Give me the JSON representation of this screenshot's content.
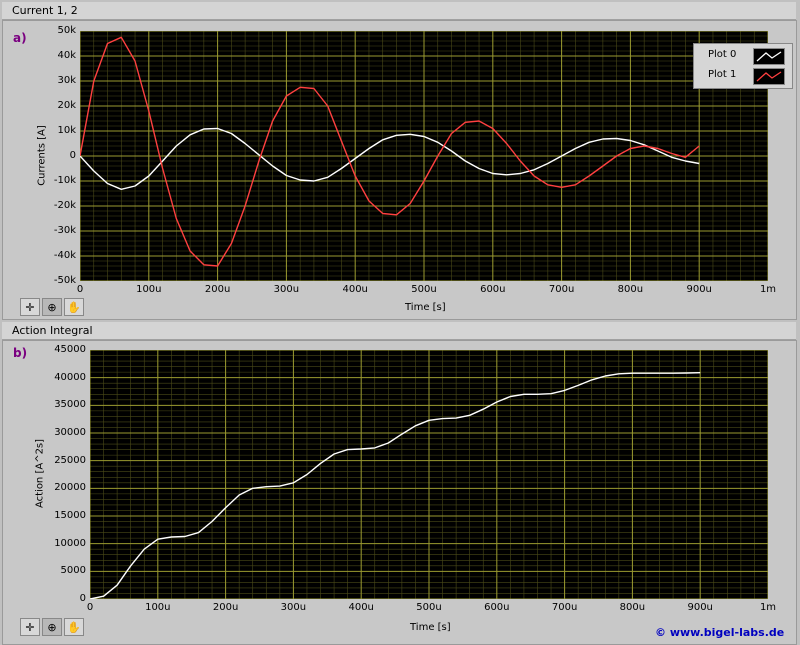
{
  "window": {
    "title": "Current 1, 2"
  },
  "colors": {
    "grid_major": "#9a9a30",
    "grid_minor": "#4a4a18",
    "series0": "#ffffff",
    "series1": "#ff4040",
    "background": "#000000"
  },
  "chart_data": [
    {
      "panel_label": "a)",
      "type": "line",
      "xlabel": "Time [s]",
      "ylabel": "Currents [A]",
      "xlim": [
        0,
        0.001
      ],
      "ylim": [
        -50000,
        50000
      ],
      "x_ticks": [
        "0",
        "100u",
        "200u",
        "300u",
        "400u",
        "500u",
        "600u",
        "700u",
        "800u",
        "900u",
        "1m"
      ],
      "y_ticks": [
        "50k",
        "40k",
        "30k",
        "20k",
        "10k",
        "0",
        "-10k",
        "-20k",
        "-30k",
        "-40k",
        "-50k"
      ],
      "legend": "top-right",
      "grid": true,
      "series": [
        {
          "name": "Plot 0",
          "color": "#ffffff",
          "x": [
            0,
            2e-05,
            4e-05,
            6e-05,
            8e-05,
            0.0001,
            0.00012,
            0.00014,
            0.00016,
            0.00018,
            0.0002,
            0.00022,
            0.00024,
            0.00026,
            0.00028,
            0.0003,
            0.00032,
            0.00034,
            0.00036,
            0.00038,
            0.0004,
            0.00042,
            0.00044,
            0.00046,
            0.00048,
            0.0005,
            0.00052,
            0.00054,
            0.00056,
            0.00058,
            0.0006,
            0.00062,
            0.00064,
            0.00066,
            0.00068,
            0.0007,
            0.00072,
            0.00074,
            0.00076,
            0.00078,
            0.0008,
            0.00082,
            0.00084,
            0.00086,
            0.00088,
            0.0009
          ],
          "y": [
            0,
            -6000,
            -11000,
            -13300,
            -12000,
            -8000,
            -2000,
            4000,
            8500,
            10800,
            11000,
            9000,
            5000,
            500,
            -4000,
            -7800,
            -9600,
            -10000,
            -8500,
            -5000,
            -1000,
            3000,
            6500,
            8300,
            8700,
            7800,
            5500,
            2000,
            -2000,
            -5000,
            -7000,
            -7500,
            -7000,
            -5500,
            -3000,
            0,
            3000,
            5500,
            6800,
            7000,
            6200,
            4500,
            2000,
            -500,
            -2000,
            -3000
          ]
        },
        {
          "name": "Plot 1",
          "color": "#ff4040",
          "x": [
            0,
            2e-05,
            4e-05,
            6e-05,
            8e-05,
            0.0001,
            0.00012,
            0.00014,
            0.00016,
            0.00018,
            0.0002,
            0.00022,
            0.00024,
            0.00026,
            0.00028,
            0.0003,
            0.00032,
            0.00034,
            0.00036,
            0.00038,
            0.0004,
            0.00042,
            0.00044,
            0.00046,
            0.00048,
            0.0005,
            0.00052,
            0.00054,
            0.00056,
            0.00058,
            0.0006,
            0.00062,
            0.00064,
            0.00066,
            0.00068,
            0.0007,
            0.00072,
            0.00074,
            0.00076,
            0.00078,
            0.0008,
            0.00082,
            0.00084,
            0.00086,
            0.00088,
            0.0009
          ],
          "y": [
            0,
            30000,
            45000,
            47500,
            38000,
            18000,
            -5000,
            -25000,
            -38000,
            -43500,
            -44000,
            -35000,
            -20000,
            -2000,
            14000,
            24000,
            27500,
            27000,
            20000,
            6000,
            -8000,
            -18000,
            -23000,
            -23500,
            -19000,
            -10000,
            0,
            9000,
            13500,
            14000,
            11000,
            5000,
            -2000,
            -8000,
            -11500,
            -12500,
            -11500,
            -8000,
            -4000,
            0,
            3000,
            4000,
            3000,
            1000,
            -500,
            4000
          ]
        }
      ]
    },
    {
      "panel_title": "Action Integral",
      "panel_label": "b)",
      "type": "line",
      "xlabel": "Time [s]",
      "ylabel": "Action [A^2s]",
      "xlim": [
        0,
        0.001
      ],
      "ylim": [
        0,
        45000
      ],
      "x_ticks": [
        "0",
        "100u",
        "200u",
        "300u",
        "400u",
        "500u",
        "600u",
        "700u",
        "800u",
        "900u",
        "1m"
      ],
      "y_ticks": [
        "45000",
        "40000",
        "35000",
        "30000",
        "25000",
        "20000",
        "15000",
        "10000",
        "5000",
        "0"
      ],
      "grid": true,
      "series": [
        {
          "color": "#ffffff",
          "x": [
            0,
            2e-05,
            4e-05,
            6e-05,
            8e-05,
            0.0001,
            0.00012,
            0.00014,
            0.00016,
            0.00018,
            0.0002,
            0.00022,
            0.00024,
            0.00026,
            0.00028,
            0.0003,
            0.00032,
            0.00034,
            0.00036,
            0.00038,
            0.0004,
            0.00042,
            0.00044,
            0.00046,
            0.00048,
            0.0005,
            0.00052,
            0.00054,
            0.00056,
            0.00058,
            0.0006,
            0.00062,
            0.00064,
            0.00066,
            0.00068,
            0.0007,
            0.00072,
            0.00074,
            0.00076,
            0.00078,
            0.0008,
            0.00082,
            0.00084,
            0.00086,
            0.00088,
            0.0009
          ],
          "y": [
            0,
            500,
            2500,
            6000,
            9000,
            10800,
            11200,
            11300,
            12000,
            14000,
            16500,
            18800,
            20000,
            20300,
            20400,
            21000,
            22500,
            24500,
            26200,
            27000,
            27100,
            27300,
            28200,
            29800,
            31300,
            32300,
            32600,
            32700,
            33200,
            34300,
            35600,
            36600,
            37000,
            37000,
            37100,
            37700,
            38600,
            39600,
            40300,
            40700,
            40800,
            40800,
            40800,
            40800,
            40850,
            40900
          ]
        }
      ]
    }
  ],
  "toolbar": {
    "cursor_tool": "crosshair-icon",
    "zoom_tool": "zoom-icon",
    "pan_tool": "hand-icon"
  },
  "footer": {
    "copyright": "© www.bigel-labs.de"
  }
}
